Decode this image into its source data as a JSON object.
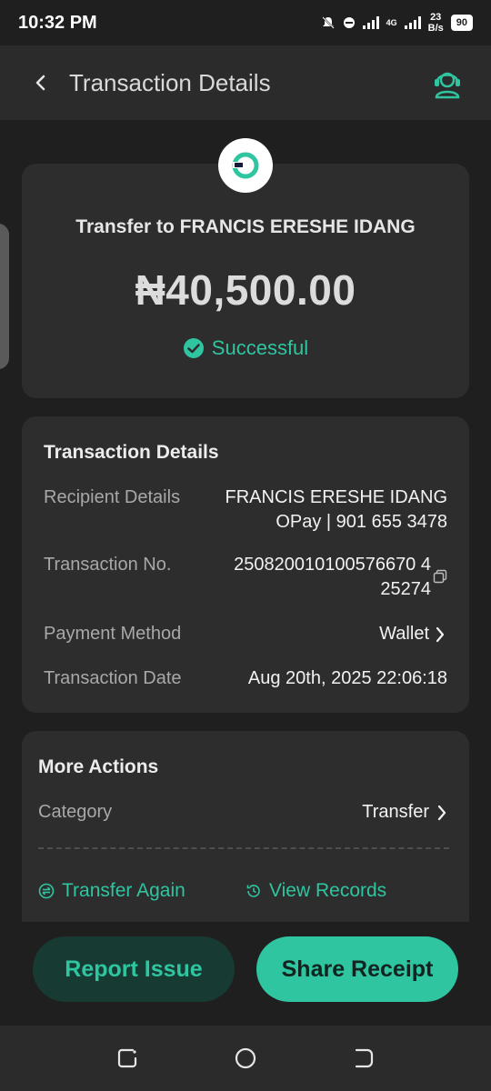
{
  "status_bar": {
    "time": "10:32 PM",
    "network_gen": "4G",
    "net_speed_value": "23",
    "net_speed_unit": "B/s",
    "battery": "90"
  },
  "header": {
    "title": "Transaction Details"
  },
  "summary": {
    "title": "Transfer to FRANCIS ERESHE IDANG",
    "amount": "₦40,500.00",
    "status": "Successful"
  },
  "details": {
    "heading": "Transaction Details",
    "rows": [
      {
        "label": "Recipient Details",
        "value_line1": "FRANCIS ERESHE IDANG",
        "value_line2": "OPay | 901 655 3478"
      },
      {
        "label": "Transaction No.",
        "value_line1": "250820010100576670 4",
        "value_line2": "25274"
      },
      {
        "label": "Payment Method",
        "value_line1": "Wallet"
      },
      {
        "label": "Transaction Date",
        "value_line1": "Aug 20th, 2025 22:06:18"
      }
    ]
  },
  "actions": {
    "heading": "More Actions",
    "category_label": "Category",
    "category_value": "Transfer",
    "transfer_again": "Transfer Again",
    "view_records": "View Records"
  },
  "buttons": {
    "report": "Report Issue",
    "share": "Share Receipt"
  },
  "colors": {
    "accent": "#2ec5a0",
    "background": "#1f1f1f",
    "card": "#2d2d2d"
  }
}
